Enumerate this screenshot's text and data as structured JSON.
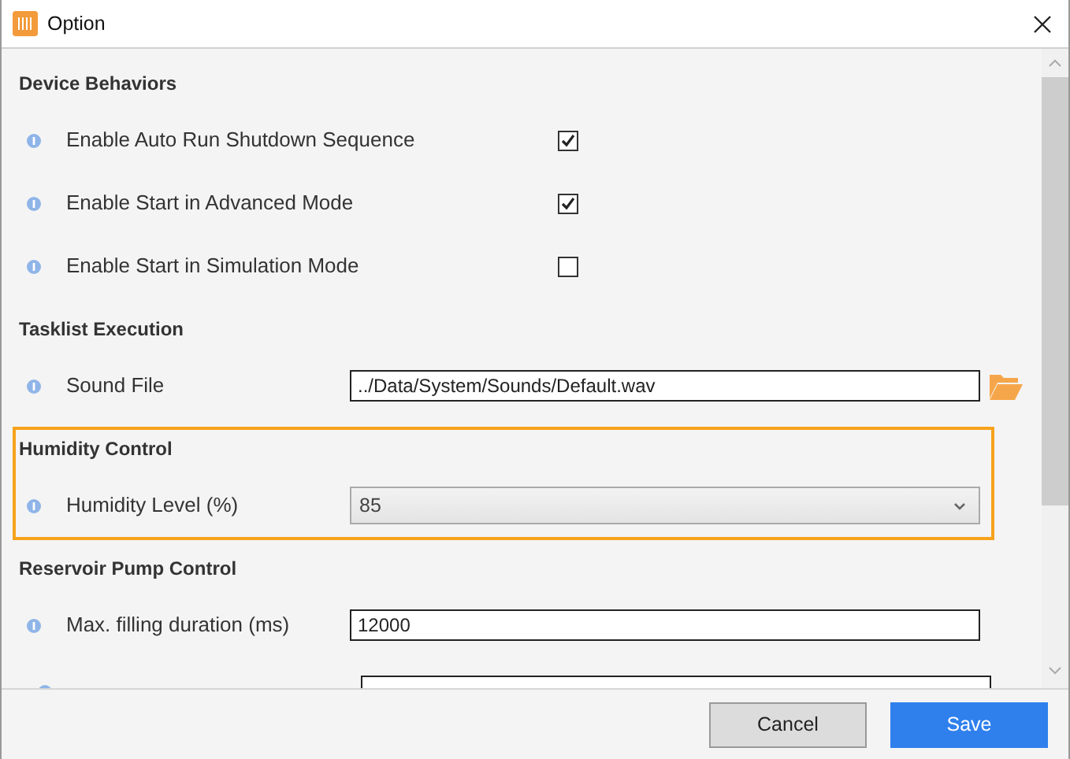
{
  "window": {
    "title": "Option"
  },
  "sections": [
    {
      "title": "Device Behaviors",
      "highlighted": false,
      "rows": [
        {
          "kind": "checkbox",
          "label": "Enable Auto Run Shutdown Sequence",
          "checked": true
        },
        {
          "kind": "checkbox",
          "label": "Enable Start in Advanced Mode",
          "checked": true
        },
        {
          "kind": "checkbox",
          "label": "Enable Start in Simulation Mode",
          "checked": false
        }
      ]
    },
    {
      "title": "Tasklist Execution",
      "highlighted": false,
      "rows": [
        {
          "kind": "file",
          "label": "Sound File",
          "value": "../Data/System/Sounds/Default.wav"
        }
      ]
    },
    {
      "title": "Humidity Control",
      "highlighted": true,
      "rows": [
        {
          "kind": "dropdown",
          "label": "Humidity Level (%)",
          "value": "85"
        }
      ]
    },
    {
      "title": "Reservoir Pump Control",
      "highlighted": false,
      "rows": [
        {
          "kind": "text",
          "label": "Max. filling duration (ms)",
          "value": "12000"
        }
      ]
    }
  ],
  "buttons": [
    {
      "label": "Cancel",
      "kind": "secondary"
    },
    {
      "label": "Save",
      "kind": "primary"
    }
  ]
}
